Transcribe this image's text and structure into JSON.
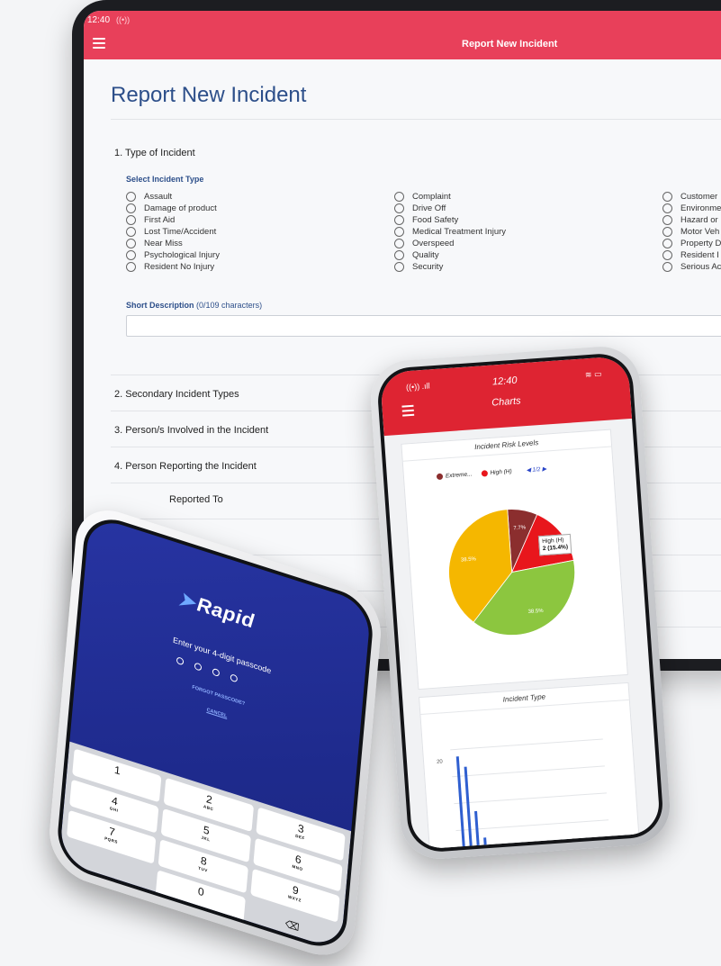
{
  "tablet": {
    "status_time": "12:40",
    "app_title": "Report New Incident",
    "page_title": "Report New Incident",
    "section1": "1. Type of Incident",
    "select_label": "Select Incident Type",
    "options_col1": [
      "Assault",
      "Damage of product",
      "First Aid",
      "Lost Time/Accident",
      "Near Miss",
      "Psychological Injury",
      "Resident No Injury"
    ],
    "options_col2": [
      "Complaint",
      "Drive Off",
      "Food Safety",
      "Medical Treatment Injury",
      "Overspeed",
      "Quality",
      "Security"
    ],
    "options_col3": [
      "Customer",
      "Environme",
      "Hazard or",
      "Motor Veh",
      "Property D",
      "Resident I",
      "Serious Ac"
    ],
    "short_desc_label": "Short Description",
    "short_desc_count": "(0/109 characters)",
    "sections": [
      "2. Secondary Incident Types",
      "3. Person/s Involved in the Incident",
      "4. Person Reporting the Incident",
      "Reported To"
    ]
  },
  "charts_phone": {
    "time": "12:40",
    "title": "Charts",
    "card1_title": "Incident Risk Levels",
    "legend": [
      {
        "label": "Extreme...",
        "color": "#8b2e2e"
      },
      {
        "label": "High (H)",
        "color": "#e8161c"
      }
    ],
    "legend_page": "1/2",
    "tooltip_line1": "High (H)",
    "tooltip_line2": "2 (15.4%)",
    "card2_title": "Incident Type",
    "bar_axis_label": "20"
  },
  "chart_data": {
    "type": "pie",
    "title": "Incident Risk Levels",
    "slices": [
      {
        "label": "Extreme...",
        "value": 7.7,
        "color": "#8b2e2e"
      },
      {
        "label": "High (H)",
        "value": 15.4,
        "color": "#e8161c"
      },
      {
        "label": "",
        "value": 38.5,
        "color": "#8cc63f"
      },
      {
        "label": "",
        "value": 38.5,
        "color": "#f5b700"
      }
    ],
    "slice_labels": [
      "7.7%",
      "15.4%",
      "38.5%",
      "38.5%"
    ]
  },
  "passcode_phone": {
    "brand": "Rapid",
    "prompt": "Enter your 4-digit passcode",
    "forgot": "FORGOT PASSCODE?",
    "cancel": "CANCEL",
    "keys": [
      {
        "n": "1",
        "s": ""
      },
      {
        "n": "2",
        "s": "ABC"
      },
      {
        "n": "3",
        "s": "DEF"
      },
      {
        "n": "4",
        "s": "GHI"
      },
      {
        "n": "5",
        "s": "JKL"
      },
      {
        "n": "6",
        "s": "MNO"
      },
      {
        "n": "7",
        "s": "PQRS"
      },
      {
        "n": "8",
        "s": "TUV"
      },
      {
        "n": "9",
        "s": "WXYZ"
      },
      {
        "n": "",
        "s": ""
      },
      {
        "n": "0",
        "s": ""
      },
      {
        "n": "⌫",
        "s": ""
      }
    ]
  }
}
